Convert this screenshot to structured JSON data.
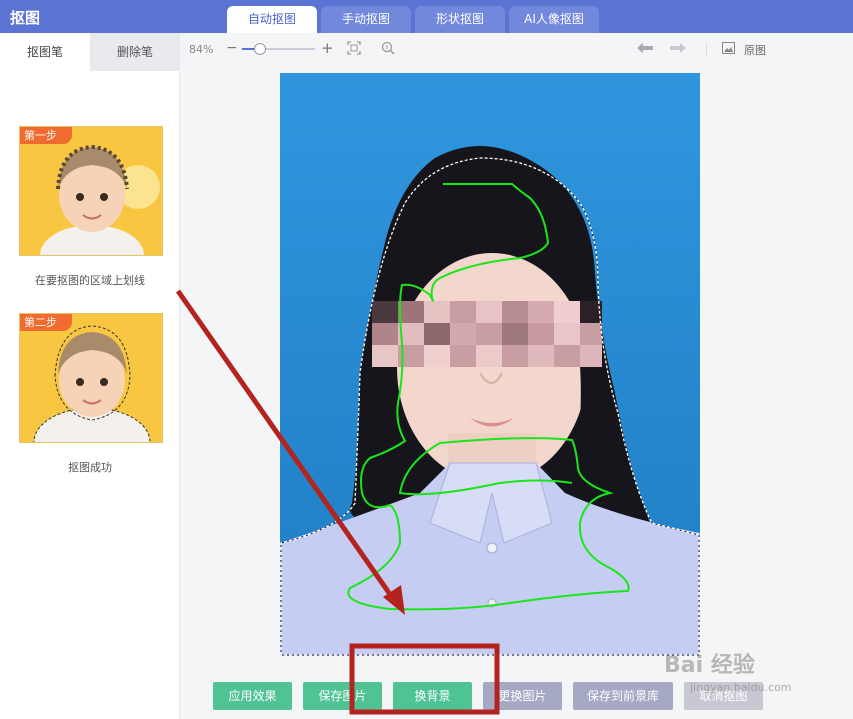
{
  "app": {
    "title": "抠图"
  },
  "tabs": [
    {
      "label": "自动抠图",
      "active": true
    },
    {
      "label": "手动抠图",
      "active": false
    },
    {
      "label": "形状抠图",
      "active": false
    },
    {
      "label": "AI人像抠图",
      "active": false
    }
  ],
  "left_panel": {
    "pen_tabs": [
      {
        "label": "抠图笔",
        "active": true
      },
      {
        "label": "删除笔",
        "active": false
      }
    ],
    "steps": [
      {
        "badge": "第一步",
        "caption": "在要抠图的区域上划线"
      },
      {
        "badge": "第二步",
        "caption": "抠图成功"
      }
    ]
  },
  "toolbar": {
    "zoom_label": "84%",
    "zoom_level": 0.25,
    "original_label": "原图",
    "icons": [
      "zoom-out-icon",
      "zoom-in-icon",
      "fit-icon",
      "magnifier-icon",
      "undo-icon",
      "redo-icon",
      "image-icon"
    ]
  },
  "buttons": [
    {
      "label": "应用效果",
      "style": "green"
    },
    {
      "label": "保存图片",
      "style": "green"
    },
    {
      "label": "换背景",
      "style": "green"
    },
    {
      "label": "更换图片",
      "style": "gray"
    },
    {
      "label": "保存到前景库",
      "style": "gray"
    },
    {
      "label": "取消抠图",
      "style": "lightgray"
    }
  ],
  "watermark": {
    "brand": "Bai 经验",
    "url": "jingyan.baidu.com"
  },
  "colors": {
    "topbar": "#5b73d3",
    "accent_green": "#4fc394",
    "annotation_red": "#b3241e",
    "stroke_green": "#19e619",
    "photo_bg": "#2d8fd6"
  }
}
